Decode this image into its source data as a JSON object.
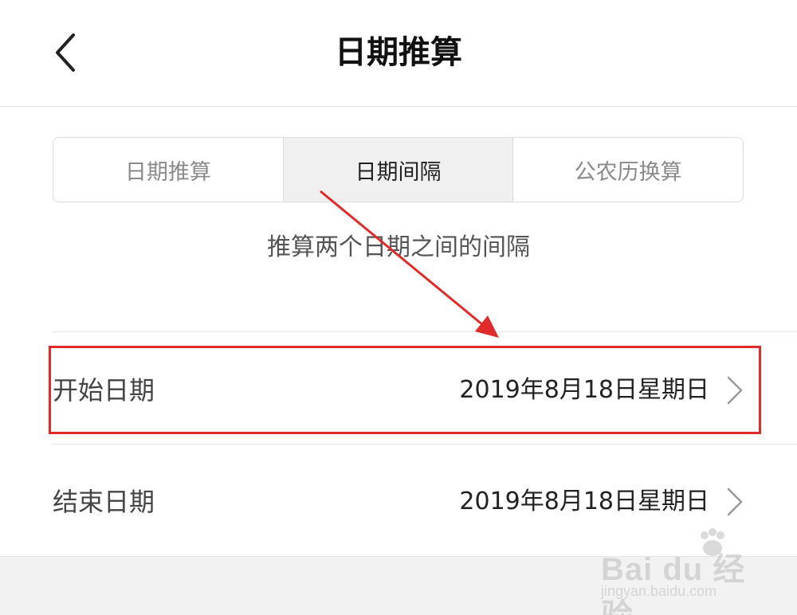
{
  "header": {
    "title": "日期推算",
    "back_icon": "chevron-left-icon"
  },
  "tabs": [
    {
      "label": "日期推算",
      "active": false
    },
    {
      "label": "日期间隔",
      "active": true
    },
    {
      "label": "公农历换算",
      "active": false
    }
  ],
  "description": "推算两个日期之间的间隔",
  "rows": [
    {
      "label": "开始日期",
      "value": "2019年8月18日星期日"
    },
    {
      "label": "结束日期",
      "value": "2019年8月18日星期日"
    }
  ],
  "annotation": {
    "color": "#e02b2b"
  },
  "watermark": {
    "brand": "Bai du 经验",
    "url": "jingyan.baidu.com"
  },
  "colors": {
    "active_tab_bg": "#f0f0f0",
    "divider": "#e4e4e4"
  }
}
